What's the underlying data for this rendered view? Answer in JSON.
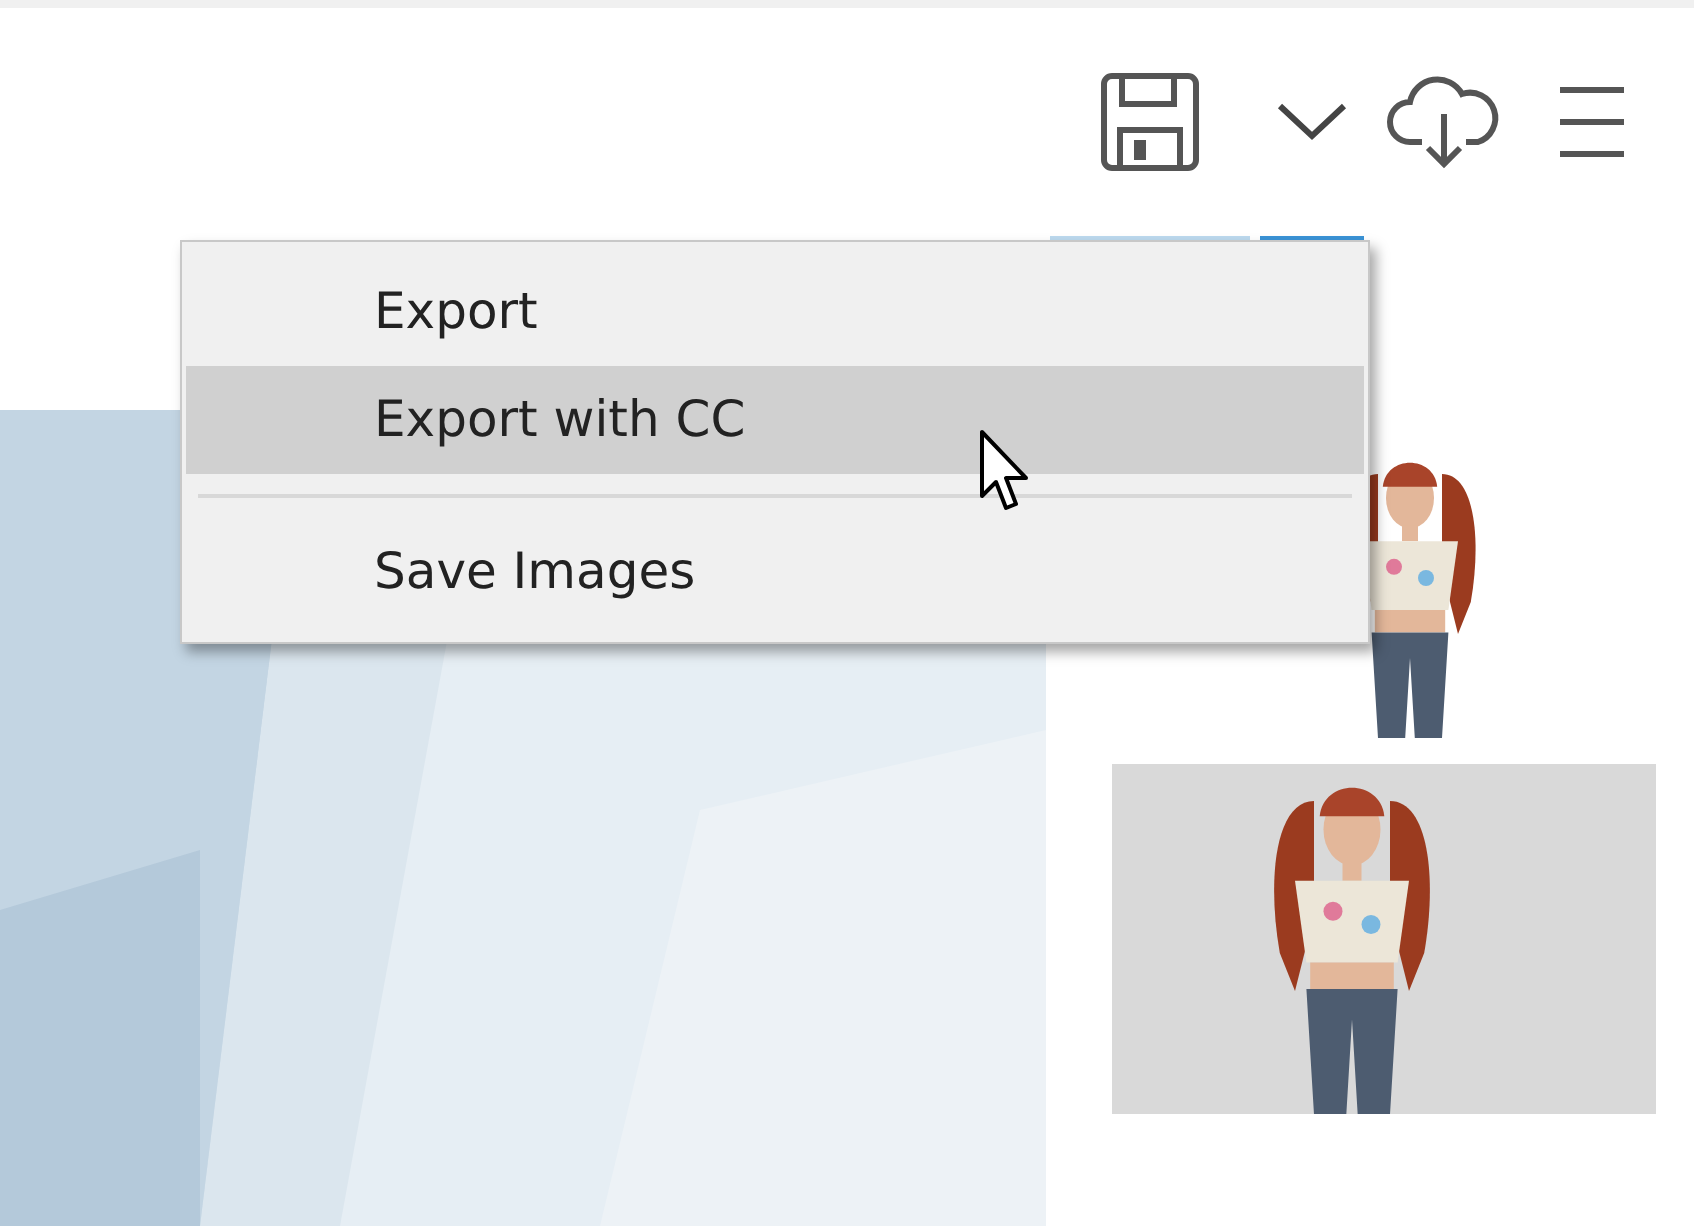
{
  "toolbar": {
    "items": [
      {
        "kind": "save",
        "highlighted": true,
        "selected": false
      },
      {
        "kind": "chevron",
        "highlighted": false,
        "selected": true
      },
      {
        "kind": "cloud",
        "highlighted": false,
        "selected": false
      },
      {
        "kind": "menu",
        "highlighted": false,
        "selected": false
      }
    ]
  },
  "dropdown_menu": {
    "items": [
      {
        "kind": "item",
        "label": "Export",
        "selected": false
      },
      {
        "kind": "item",
        "label": "Export with CC",
        "selected": true
      },
      {
        "kind": "separator"
      },
      {
        "kind": "item",
        "label": "Save Images",
        "selected": false
      }
    ]
  }
}
